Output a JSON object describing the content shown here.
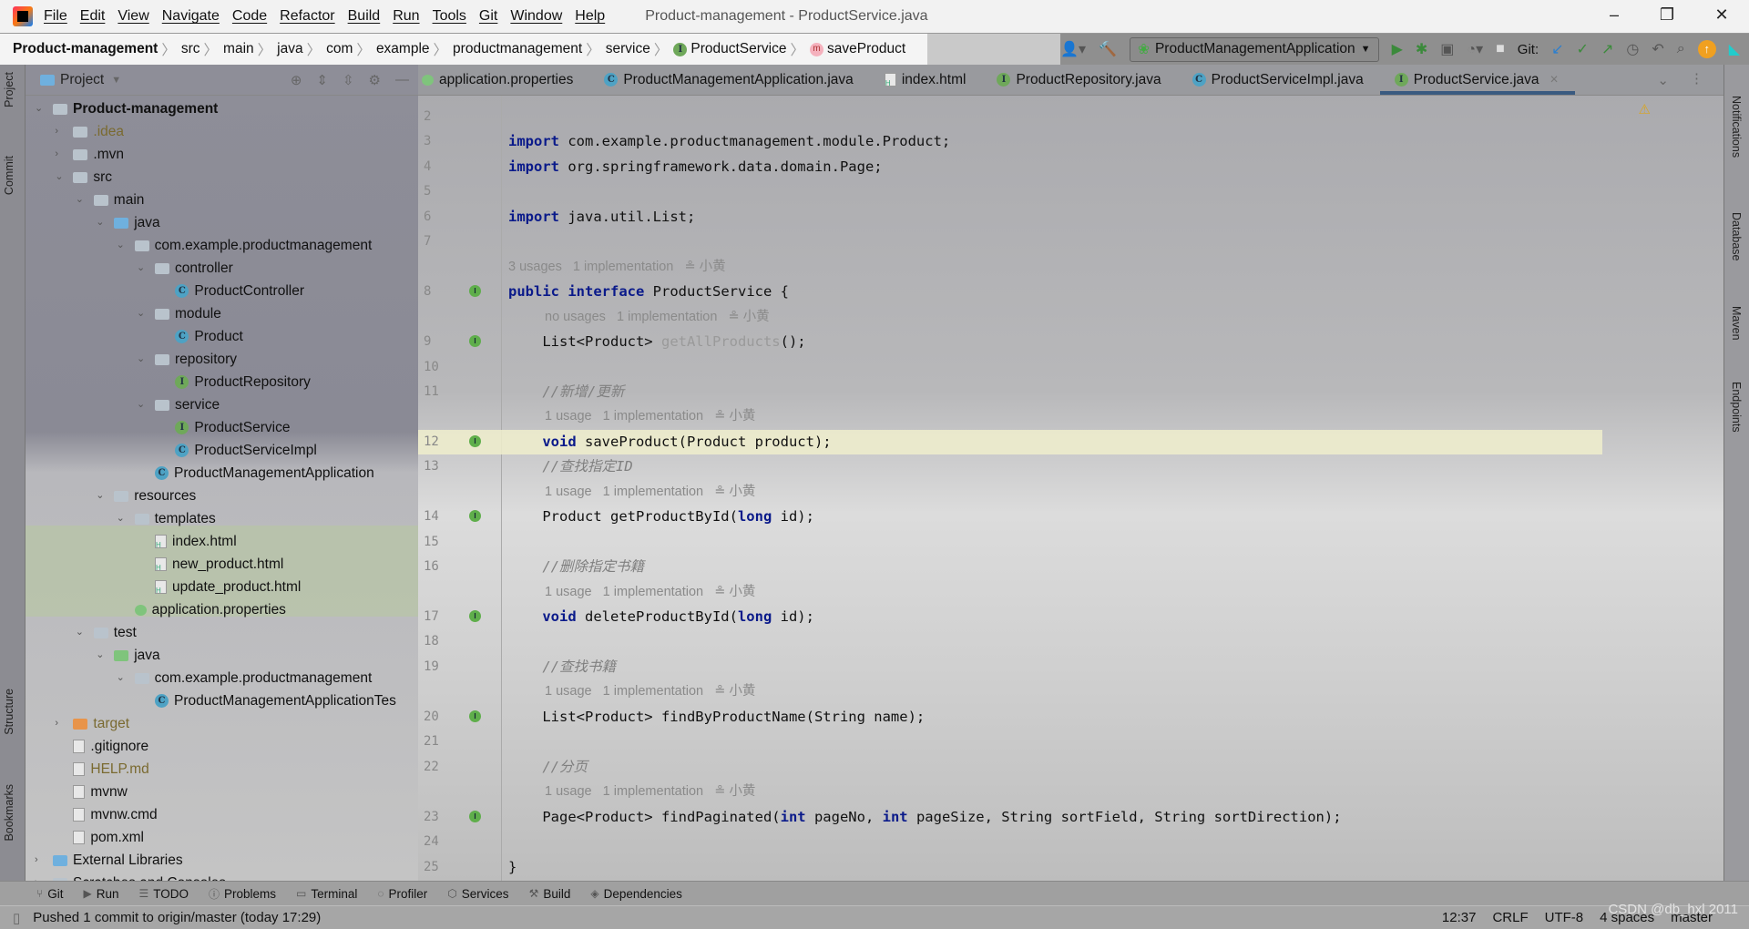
{
  "menu": [
    "File",
    "Edit",
    "View",
    "Navigate",
    "Code",
    "Refactor",
    "Build",
    "Run",
    "Tools",
    "Git",
    "Window",
    "Help"
  ],
  "window_title": "Product-management - ProductService.java",
  "breadcrumb": [
    "Product-management",
    "src",
    "main",
    "java",
    "com",
    "example",
    "productmanagement",
    "service",
    "ProductService",
    "saveProduct"
  ],
  "toolbar": {
    "run_config": "ProductManagementApplication",
    "git_label": "Git:"
  },
  "left_stripe": [
    "Project",
    "Commit",
    "Structure",
    "Bookmarks"
  ],
  "right_stripe": [
    "Notifications",
    "Database",
    "Maven",
    "Endpoints"
  ],
  "project_panel": {
    "title": "Project",
    "tree": [
      {
        "label": "Product-management",
        "level": 0,
        "arrow": "down",
        "icon": "folder",
        "bold": true
      },
      {
        "label": ".idea",
        "level": 1,
        "arrow": "right",
        "icon": "folder",
        "color": "#7a6a30"
      },
      {
        "label": ".mvn",
        "level": 1,
        "arrow": "right",
        "icon": "folder"
      },
      {
        "label": "src",
        "level": 1,
        "arrow": "down",
        "icon": "folder"
      },
      {
        "label": "main",
        "level": 2,
        "arrow": "down",
        "icon": "folder"
      },
      {
        "label": "java",
        "level": 3,
        "arrow": "down",
        "icon": "folder-blue"
      },
      {
        "label": "com.example.productmanagement",
        "level": 4,
        "arrow": "down",
        "icon": "package"
      },
      {
        "label": "controller",
        "level": 5,
        "arrow": "down",
        "icon": "package"
      },
      {
        "label": "ProductController",
        "level": 6,
        "icon": "class"
      },
      {
        "label": "module",
        "level": 5,
        "arrow": "down",
        "icon": "package"
      },
      {
        "label": "Product",
        "level": 6,
        "icon": "class"
      },
      {
        "label": "repository",
        "level": 5,
        "arrow": "down",
        "icon": "package"
      },
      {
        "label": "ProductRepository",
        "level": 6,
        "icon": "interface"
      },
      {
        "label": "service",
        "level": 5,
        "arrow": "down",
        "icon": "package"
      },
      {
        "label": "ProductService",
        "level": 6,
        "icon": "interface"
      },
      {
        "label": "ProductServiceImpl",
        "level": 6,
        "icon": "class"
      },
      {
        "label": "ProductManagementApplication",
        "level": 5,
        "icon": "class"
      },
      {
        "label": "resources",
        "level": 3,
        "arrow": "down",
        "icon": "folder"
      },
      {
        "label": "templates",
        "level": 4,
        "arrow": "down",
        "icon": "folder"
      },
      {
        "label": "index.html",
        "level": 5,
        "icon": "html"
      },
      {
        "label": "new_product.html",
        "level": 5,
        "icon": "html"
      },
      {
        "label": "update_product.html",
        "level": 5,
        "icon": "html"
      },
      {
        "label": "application.properties",
        "level": 4,
        "icon": "properties"
      },
      {
        "label": "test",
        "level": 2,
        "arrow": "down",
        "icon": "folder"
      },
      {
        "label": "java",
        "level": 3,
        "arrow": "down",
        "icon": "folder-green"
      },
      {
        "label": "com.example.productmanagement",
        "level": 4,
        "arrow": "down",
        "icon": "package"
      },
      {
        "label": "ProductManagementApplicationTes",
        "level": 5,
        "icon": "class"
      },
      {
        "label": "target",
        "level": 1,
        "arrow": "right",
        "icon": "folder-orange",
        "color": "#7a6a30"
      },
      {
        "label": ".gitignore",
        "level": 1,
        "icon": "file"
      },
      {
        "label": "HELP.md",
        "level": 1,
        "icon": "markdown",
        "color": "#7a6a30"
      },
      {
        "label": "mvnw",
        "level": 1,
        "icon": "file"
      },
      {
        "label": "mvnw.cmd",
        "level": 1,
        "icon": "file"
      },
      {
        "label": "pom.xml",
        "level": 1,
        "icon": "file"
      },
      {
        "label": "External Libraries",
        "level": 0,
        "arrow": "right",
        "icon": "library"
      },
      {
        "label": "Scratches and Consoles",
        "level": 0,
        "arrow": "right",
        "icon": "scratch"
      }
    ]
  },
  "tabs": [
    {
      "label": "application.properties",
      "icon": "properties"
    },
    {
      "label": "ProductManagementApplication.java",
      "icon": "class"
    },
    {
      "label": "index.html",
      "icon": "html"
    },
    {
      "label": "ProductRepository.java",
      "icon": "interface"
    },
    {
      "label": "ProductServiceImpl.java",
      "icon": "class"
    },
    {
      "label": "ProductService.java",
      "icon": "interface",
      "active": true
    }
  ],
  "code": [
    {
      "n": "2"
    },
    {
      "n": "3",
      "t": [
        [
          "import",
          "kw"
        ],
        [
          " com.example.productmanagement.module.Product;",
          ""
        ]
      ]
    },
    {
      "n": "4",
      "t": [
        [
          "import",
          "kw"
        ],
        [
          " org.springframework.data.domain.Page;",
          ""
        ]
      ]
    },
    {
      "n": "5"
    },
    {
      "n": "6",
      "t": [
        [
          "import",
          "kw"
        ],
        [
          " java.util.List;",
          ""
        ]
      ]
    },
    {
      "n": "7"
    },
    {
      "hint": "3 usages   1 implementation   ≗ 小黄",
      "indent": 0
    },
    {
      "n": "8",
      "g": true,
      "t": [
        [
          "public",
          "kw"
        ],
        [
          " ",
          ""
        ],
        [
          "interface",
          "kw"
        ],
        [
          " ProductService {",
          ""
        ]
      ]
    },
    {
      "hint": "no usages   1 implementation   ≗ 小黄",
      "indent": 1
    },
    {
      "n": "9",
      "g": true,
      "t": [
        [
          "    List<Product> ",
          ""
        ],
        [
          "getAllProducts",
          "un"
        ],
        [
          "();",
          ""
        ]
      ]
    },
    {
      "n": "10"
    },
    {
      "n": "11",
      "t": [
        [
          "    //新增/更新",
          "cm"
        ]
      ]
    },
    {
      "hint": "1 usage   1 implementation   ≗ 小黄",
      "indent": 1
    },
    {
      "n": "12",
      "g": true,
      "hl": true,
      "t": [
        [
          "    ",
          ""
        ],
        [
          "void",
          "kw"
        ],
        [
          " saveProduct(Product product);",
          ""
        ]
      ]
    },
    {
      "n": "13",
      "t": [
        [
          "    //查找指定ID",
          "cm"
        ]
      ]
    },
    {
      "hint": "1 usage   1 implementation   ≗ 小黄",
      "indent": 1
    },
    {
      "n": "14",
      "g": true,
      "t": [
        [
          "    Product getProductById(",
          ""
        ],
        [
          "long",
          "kw"
        ],
        [
          " id);",
          ""
        ]
      ]
    },
    {
      "n": "15"
    },
    {
      "n": "16",
      "t": [
        [
          "    //删除指定书籍",
          "cm"
        ]
      ]
    },
    {
      "hint": "1 usage   1 implementation   ≗ 小黄",
      "indent": 1
    },
    {
      "n": "17",
      "g": true,
      "t": [
        [
          "    ",
          ""
        ],
        [
          "void",
          "kw"
        ],
        [
          " deleteProductById(",
          ""
        ],
        [
          "long",
          "kw"
        ],
        [
          " id);",
          ""
        ]
      ]
    },
    {
      "n": "18"
    },
    {
      "n": "19",
      "t": [
        [
          "    //查找书籍",
          "cm"
        ]
      ]
    },
    {
      "hint": "1 usage   1 implementation   ≗ 小黄",
      "indent": 1
    },
    {
      "n": "20",
      "g": true,
      "t": [
        [
          "    List<Product> findByProductName(String name);",
          ""
        ]
      ]
    },
    {
      "n": "21"
    },
    {
      "n": "22",
      "t": [
        [
          "    //分页",
          "cm"
        ]
      ]
    },
    {
      "hint": "1 usage   1 implementation   ≗ 小黄",
      "indent": 1
    },
    {
      "n": "23",
      "g": true,
      "t": [
        [
          "    Page<Product> findPaginated(",
          ""
        ],
        [
          "int",
          "kw"
        ],
        [
          " pageNo, ",
          ""
        ],
        [
          "int",
          "kw"
        ],
        [
          " pageSize, String sortField, String sortDirection);",
          ""
        ]
      ]
    },
    {
      "n": "24"
    },
    {
      "n": "25",
      "t": [
        [
          "}",
          ""
        ]
      ]
    }
  ],
  "bottom_tools": [
    "Git",
    "Run",
    "TODO",
    "Problems",
    "Terminal",
    "Profiler",
    "Services",
    "Build",
    "Dependencies"
  ],
  "status": {
    "message": "Pushed 1 commit to origin/master (today 17:29)",
    "position": "12:37",
    "line_sep": "CRLF",
    "encoding": "UTF-8",
    "indent": "4 spaces",
    "branch": "master"
  },
  "watermark": "CSDN @db_hxl 2011"
}
